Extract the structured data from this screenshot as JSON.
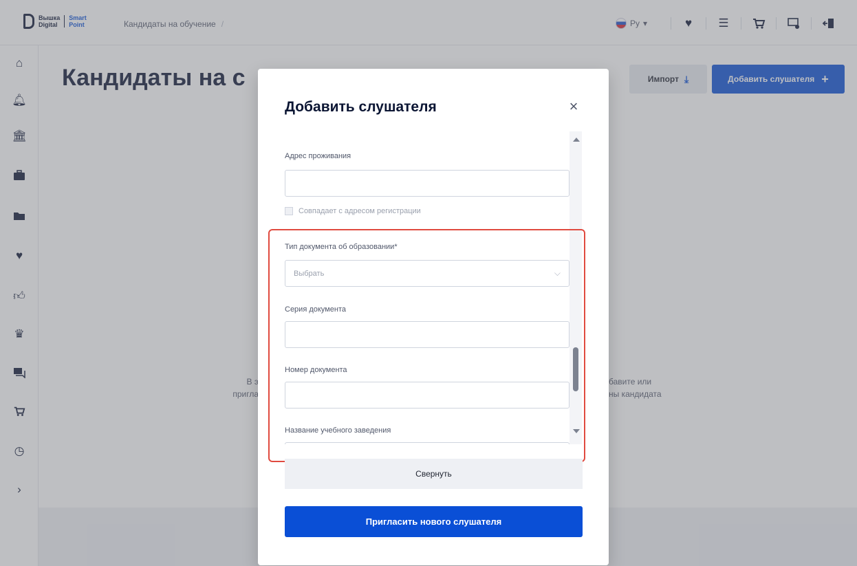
{
  "header": {
    "logo_line1": "Вышка",
    "logo_line2": "Digital",
    "logo_brand1": "Smart",
    "logo_brand2": "Point",
    "breadcrumb": "Кандидаты на обучение",
    "breadcrumb_separator": "/",
    "language": "Ру",
    "icons": [
      "heart-icon",
      "list-icon",
      "cart-icon",
      "monitor-settings-icon",
      "logout-icon"
    ]
  },
  "sidebar": {
    "icons": [
      "home-icon",
      "bell-icon",
      "institution-icon",
      "briefcase-icon",
      "folder-icon",
      "heart-icon",
      "thumbs-up-icon",
      "crown-icon",
      "chat-icon",
      "cart-icon",
      "clock-icon",
      "expand-icon"
    ]
  },
  "page": {
    "title": "Кандидаты на с",
    "import_label": "Импорт",
    "add_label": "Добавить слушателя",
    "empty_left_1": "В э",
    "empty_left_2": "пригла",
    "empty_right_1": "бавите или",
    "empty_right_2": "ны кандидата"
  },
  "modal": {
    "title": "Добавить слушателя",
    "close": "×",
    "fields": {
      "address_label": "Адрес проживания",
      "address_value": "",
      "same_as_registration": "Совпадает с адресом регистрации",
      "doc_type_label": "Тип документа об образовании*",
      "doc_type_placeholder": "Выбрать",
      "doc_series_label": "Серия документа",
      "doc_series_value": "",
      "doc_number_label": "Номер документа",
      "doc_number_value": "",
      "institution_label": "Название учебного заведения",
      "institution_value": ""
    },
    "collapse_label": "Свернуть",
    "invite_label": "Пригласить нового слушателя"
  },
  "colors": {
    "accent": "#0a4fd6",
    "highlight": "#e04a3f"
  }
}
